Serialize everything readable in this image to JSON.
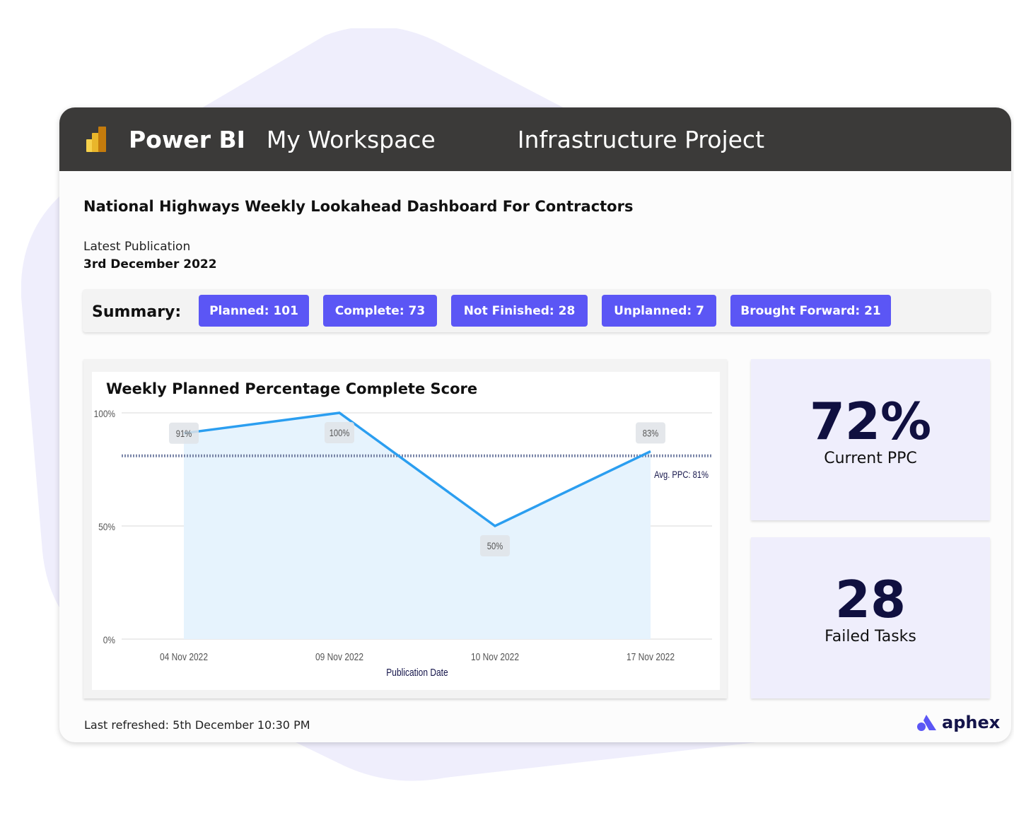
{
  "header": {
    "brand": "Power BI",
    "workspace": "My Workspace",
    "project": "Infrastructure Project"
  },
  "dashboard_title": "National Highways Weekly Lookahead Dashboard For Contractors",
  "publication": {
    "label": "Latest Publication",
    "date": "3rd December 2022"
  },
  "summary": {
    "label": "Summary:",
    "pills": [
      "Planned: 101",
      "Complete: 73",
      "Not Finished: 28",
      "Unplanned: 7",
      "Brought Forward: 21"
    ]
  },
  "kpis": [
    {
      "value": "72%",
      "label": "Current PPC"
    },
    {
      "value": "28",
      "label": "Failed Tasks"
    }
  ],
  "footer": {
    "refreshed": "Last refreshed:  5th December 10:30 PM",
    "logo_text": "aphex"
  },
  "colors": {
    "topbar": "#3b3a39",
    "accent": "#5b56f5",
    "line": "#2b9ef0",
    "area": "#e6f3fd",
    "avg_line": "#7a86a8",
    "kpi_bg": "#efeefc"
  },
  "chart_data": {
    "type": "area",
    "title": "Weekly Planned Percentage Complete Score",
    "xlabel": "Publication Date",
    "ylabel": "",
    "categories": [
      "04 Nov 2022",
      "09 Nov 2022",
      "10 Nov 2022",
      "17 Nov 2022"
    ],
    "values": [
      91,
      100,
      50,
      83
    ],
    "data_labels": [
      "91%",
      "100%",
      "50%",
      "83%"
    ],
    "yticks": [
      "0%",
      "50%",
      "100%"
    ],
    "ylim": [
      0,
      100
    ],
    "reference_line": {
      "value": 81,
      "label": "Avg. PPC: 81%"
    },
    "grid": true
  }
}
